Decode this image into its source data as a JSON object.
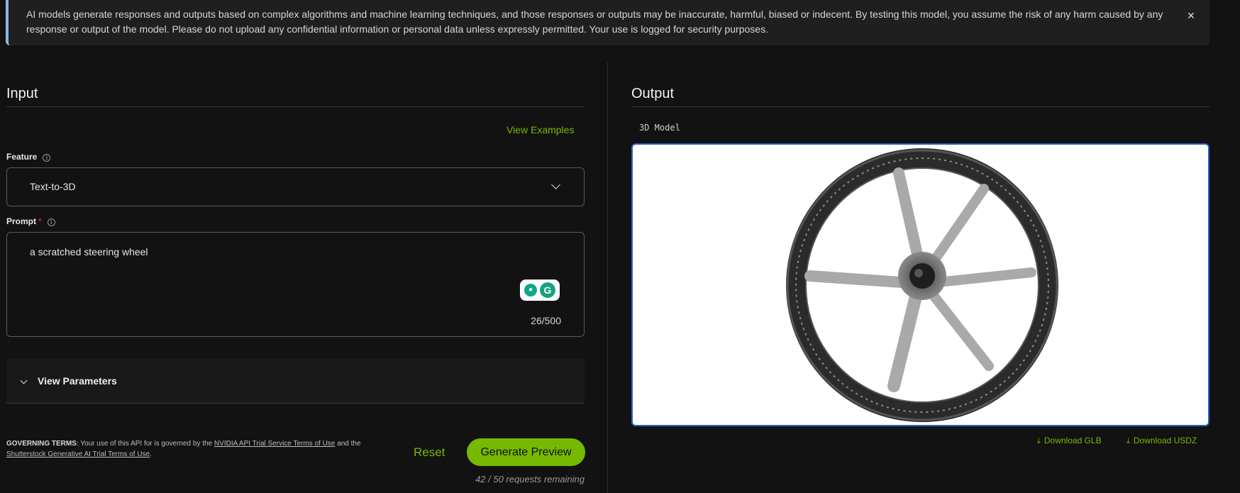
{
  "banner": {
    "text": "AI models generate responses and outputs based on complex algorithms and machine learning techniques, and those responses or outputs may be inaccurate, harmful, biased or indecent. By testing this model, you assume the risk of any harm caused by any response or output of the model. Please do not upload any confidential information or personal data unless expressly permitted. Your use is logged for security purposes.",
    "close_icon": "×"
  },
  "input": {
    "title": "Input",
    "view_examples": "View Examples",
    "feature_label": "Feature",
    "feature_value": "Text-to-3D",
    "prompt_label": "Prompt",
    "prompt_required": "*",
    "prompt_value": "a scratched steering wheel",
    "char_counter": "26/500",
    "view_parameters": "View Parameters",
    "terms": {
      "lead": "GOVERNING TERMS",
      "text1": ": Your use of this API for is governed by the ",
      "link1": "NVIDIA API Trial Service Terms of Use",
      "text2": " and the ",
      "link2": "Shutterstock Generative AI Trial Terms of Use",
      "text3": "."
    },
    "reset_label": "Reset",
    "generate_label": "Generate Preview",
    "remaining": "42 / 50 requests remaining"
  },
  "output": {
    "title": "Output",
    "model_label": "3D Model",
    "download_glb": "Download GLB",
    "download_usdz": "Download USDZ"
  },
  "colors": {
    "accent": "#76b900",
    "background": "#121212",
    "viewer_border": "#2d5fc2"
  }
}
